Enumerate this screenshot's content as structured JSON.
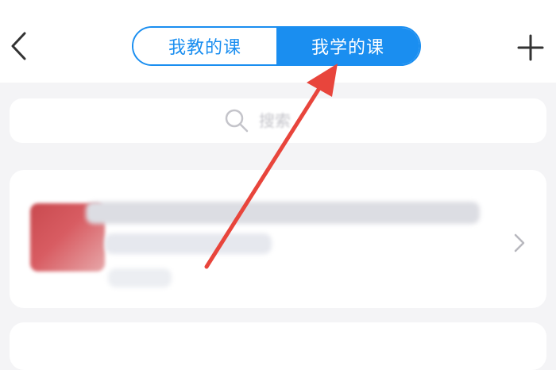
{
  "header": {
    "back_icon": "chevron-left-icon",
    "add_icon": "plus-icon",
    "tabs": [
      {
        "label": "我教的课",
        "active": false
      },
      {
        "label": "我学的课",
        "active": true
      }
    ]
  },
  "search": {
    "icon": "search-icon",
    "placeholder": "搜索"
  },
  "course_list": {
    "items": [
      {
        "title": "",
        "subtitle": "",
        "thumbnail": "course-thumbnail"
      }
    ]
  },
  "annotation": {
    "type": "arrow",
    "color": "#e8453c"
  },
  "colors": {
    "accent": "#1a8ef0",
    "background": "#f4f4f6",
    "card": "#ffffff"
  }
}
